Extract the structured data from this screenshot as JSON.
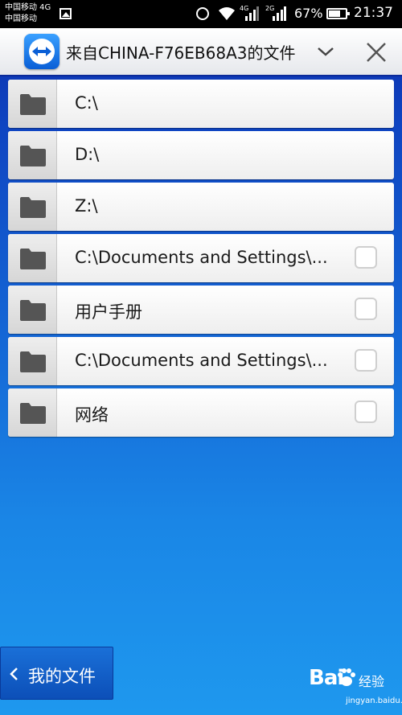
{
  "status_bar": {
    "carrier1": "中国移动 4G",
    "carrier2": "中国移动",
    "sig1_label": "4G",
    "sig2_label": "2G",
    "battery": "67%",
    "time": "21:37"
  },
  "header": {
    "title": "来自CHINA-F76EB68A3的文件"
  },
  "files": [
    {
      "label": "C:\\",
      "checkbox": false
    },
    {
      "label": "D:\\",
      "checkbox": false
    },
    {
      "label": "Z:\\",
      "checkbox": false
    },
    {
      "label": "C:\\Documents and Settings\\...",
      "checkbox": true
    },
    {
      "label": "用户手册",
      "checkbox": true
    },
    {
      "label": "C:\\Documents and Settings\\...",
      "checkbox": true
    },
    {
      "label": "网络",
      "checkbox": true
    }
  ],
  "bottom": {
    "back_label": "我的文件"
  },
  "watermark": {
    "brand": "Bai",
    "brand_suffix": "经验",
    "url": "jingyan.baidu.com"
  },
  "colors": {
    "accent": "#0a2aa8",
    "background_bottom": "#1e98ee"
  }
}
